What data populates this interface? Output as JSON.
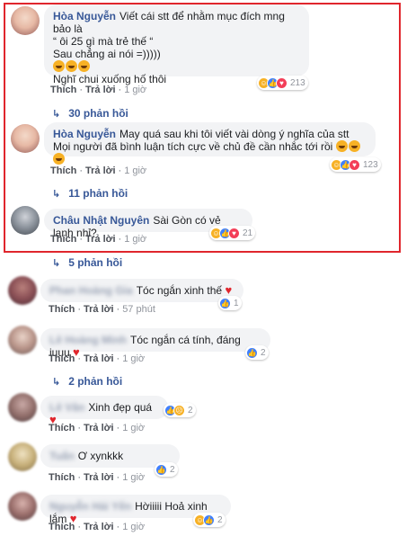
{
  "colors": {
    "highlight_border": "#e0262d",
    "link": "#385898",
    "bubble_bg": "#f2f3f5",
    "like": "#4080ff",
    "love": "#f33e58",
    "haha": "#f7b125"
  },
  "comments": [
    {
      "author": "Hòa Nguyễn",
      "lines": [
        "Viết cái stt để nhằm mục đích mng bảo là",
        "“ ôi 25 gì mà trẻ thế “",
        "Sau chẳng ai nói =)))))",
        "",
        "Nghĩ chui xuống hố thôi"
      ],
      "like": "Thích",
      "reply": "Trả lời",
      "time": "1 giờ",
      "reaction_count": "213",
      "reactions": [
        "haha-icon",
        "like-icon",
        "love-icon"
      ],
      "replies": "30 phản hồi"
    },
    {
      "author": "Hòa Nguyễn",
      "lines": [
        "May quá sau khi tôi viết vài dòng ý nghĩa của stt",
        "Mọi người đã bình luận tích cực về chủ đề cần nhắc tới rồi"
      ],
      "like": "Thích",
      "reply": "Trả lời",
      "time": "1 giờ",
      "reaction_count": "123",
      "reactions": [
        "haha-icon",
        "like-icon",
        "love-icon"
      ],
      "replies": "11 phản hồi"
    },
    {
      "author": "Châu Nhật Nguyên",
      "lines": [
        "Sài Gòn có vẻ lạnh nhỉ?"
      ],
      "like": "Thích",
      "reply": "Trả lời",
      "time": "1 giờ",
      "reaction_count": "21",
      "reactions": [
        "haha-icon",
        "like-icon",
        "love-icon"
      ],
      "replies": "5 phản hồi"
    },
    {
      "author": "Phan Hoàng Gia",
      "text": "Tóc ngắn xinh thế",
      "like": "Thích",
      "reply": "Trả lời",
      "time": "57 phút",
      "reaction_count": "1",
      "reactions": [
        "like-icon"
      ]
    },
    {
      "author": "Lê Hoàng Minh",
      "text": "Tóc ngắn cá tính, đáng iuuu",
      "like": "Thích",
      "reply": "Trả lời",
      "time": "1 giờ",
      "reaction_count": "2",
      "reactions": [
        "like-icon"
      ],
      "replies": "2 phản hồi"
    },
    {
      "author": "Lê Vân",
      "text": "Xinh đẹp quá",
      "like": "Thích",
      "reply": "Trả lời",
      "time": "1 giờ",
      "reaction_count": "2",
      "reactions": [
        "like-icon",
        "sad-icon"
      ]
    },
    {
      "author": "Tuấn",
      "text": "Ơ xynkkk",
      "like": "Thích",
      "reply": "Trả lời",
      "time": "1 giờ",
      "reaction_count": "2",
      "reactions": [
        "like-icon"
      ]
    },
    {
      "author": "Nguyễn Hải Yến",
      "text": "Hờiiiii Hoả xinh lắm",
      "like": "Thích",
      "reply": "Trả lời",
      "time": "1 giờ",
      "reaction_count": "2",
      "reactions": [
        "haha-icon",
        "like-icon"
      ]
    }
  ]
}
